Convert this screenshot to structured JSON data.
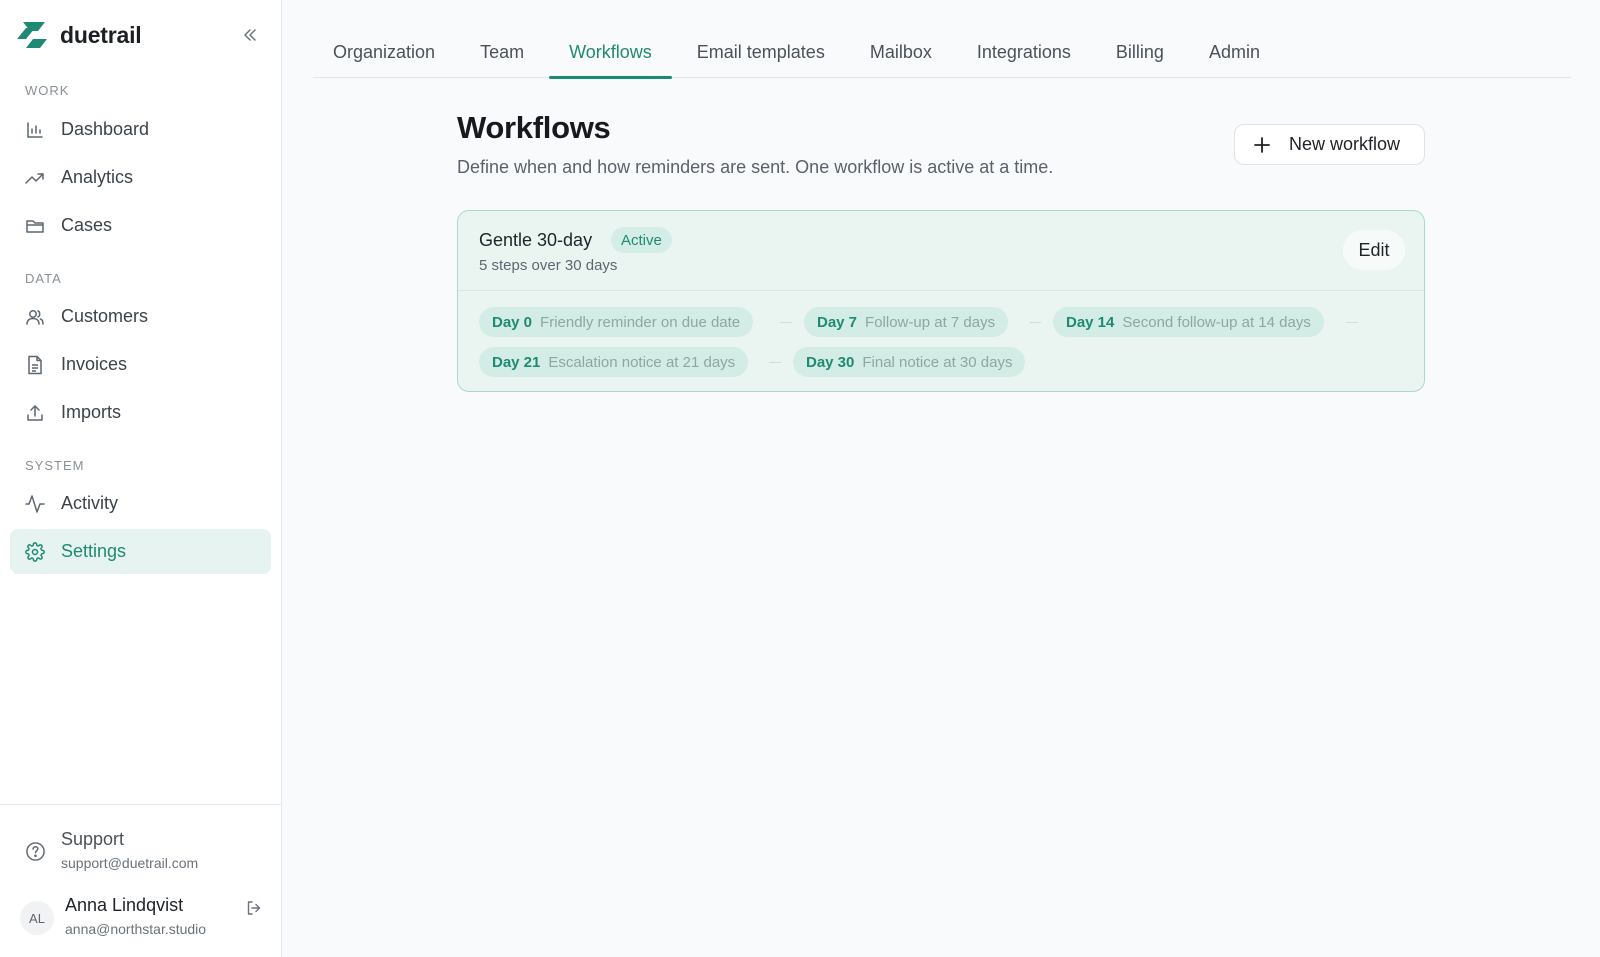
{
  "brand": {
    "name": "duetrail",
    "color": "#1f8a73"
  },
  "sidebar": {
    "sections": [
      {
        "label": "WORK",
        "items": [
          {
            "label": "Dashboard",
            "icon": "bar-chart-icon",
            "active": false
          },
          {
            "label": "Analytics",
            "icon": "trending-up-icon",
            "active": false
          },
          {
            "label": "Cases",
            "icon": "folder-icon",
            "active": false
          }
        ]
      },
      {
        "label": "DATA",
        "items": [
          {
            "label": "Customers",
            "icon": "users-icon",
            "active": false
          },
          {
            "label": "Invoices",
            "icon": "document-icon",
            "active": false
          },
          {
            "label": "Imports",
            "icon": "upload-icon",
            "active": false
          }
        ]
      },
      {
        "label": "SYSTEM",
        "items": [
          {
            "label": "Activity",
            "icon": "activity-icon",
            "active": false
          },
          {
            "label": "Settings",
            "icon": "gear-icon",
            "active": true
          }
        ]
      }
    ],
    "support": {
      "title": "Support",
      "email": "support@duetrail.com"
    },
    "user": {
      "initials": "AL",
      "name": "Anna Lindqvist",
      "email": "anna@northstar.studio"
    }
  },
  "tabs": [
    {
      "label": "Organization",
      "active": false
    },
    {
      "label": "Team",
      "active": false
    },
    {
      "label": "Workflows",
      "active": true
    },
    {
      "label": "Email templates",
      "active": false
    },
    {
      "label": "Mailbox",
      "active": false
    },
    {
      "label": "Integrations",
      "active": false
    },
    {
      "label": "Billing",
      "active": false
    },
    {
      "label": "Admin",
      "active": false
    }
  ],
  "page": {
    "title": "Workflows",
    "description": "Define when and how reminders are sent. One workflow is active at a time.",
    "new_button_label": "New workflow"
  },
  "workflow": {
    "name": "Gentle 30-day",
    "status": "Active",
    "summary": "5 steps over 30 days",
    "edit_label": "Edit",
    "steps": [
      {
        "day": "Day 0",
        "desc": "Friendly reminder on due date"
      },
      {
        "day": "Day 7",
        "desc": "Follow-up at 7 days"
      },
      {
        "day": "Day 14",
        "desc": "Second follow-up at 14 days"
      },
      {
        "day": "Day 21",
        "desc": "Escalation notice at 21 days"
      },
      {
        "day": "Day 30",
        "desc": "Final notice at 30 days"
      }
    ]
  }
}
